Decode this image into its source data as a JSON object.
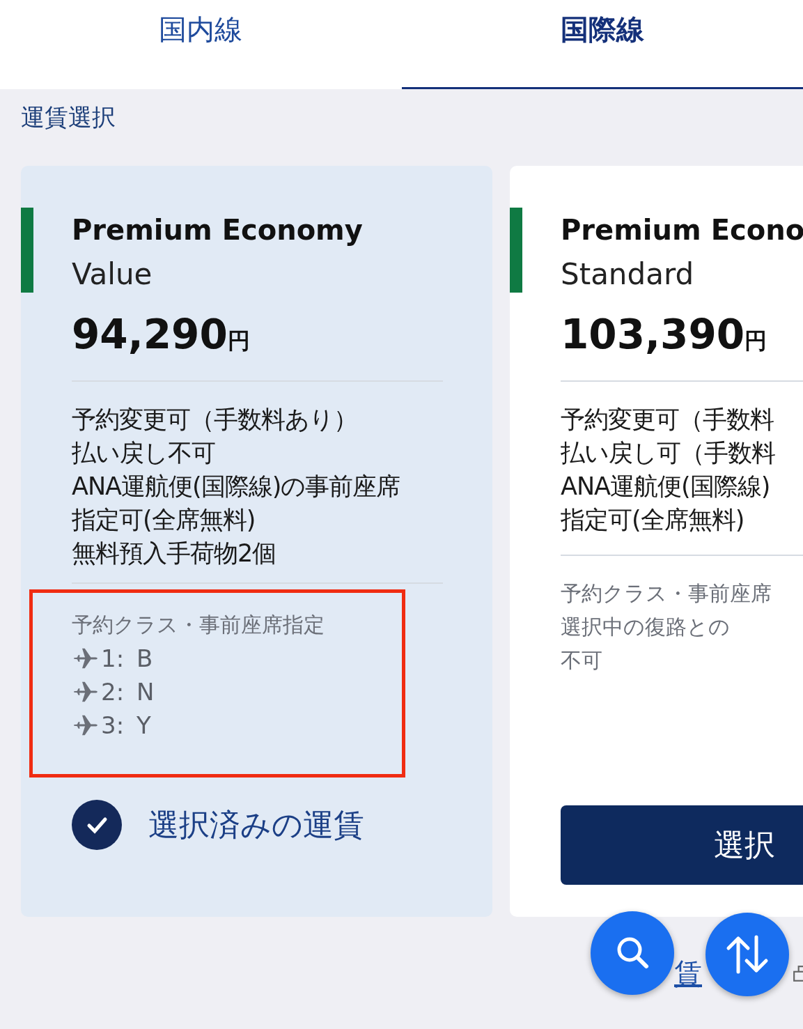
{
  "tabs": [
    {
      "label": "国内線",
      "selected": false
    },
    {
      "label": "国際線",
      "selected": true
    }
  ],
  "section_title": "運賃選択",
  "fares": [
    {
      "name": "Premium Economy",
      "type": "Value",
      "price": "94,290",
      "currency": "円",
      "conditions": [
        "予約変更可（手数料あり）",
        "払い戻し不可",
        "ANA運航便(国際線)の事前座席",
        "指定可(全席無料)",
        "無料預入手荷物2個"
      ],
      "class_heading": "予約クラス・事前座席指定",
      "class_lines": [
        {
          "segment": "1:",
          "class": "B"
        },
        {
          "segment": "2:",
          "class": "N"
        },
        {
          "segment": "3:",
          "class": "Y"
        }
      ],
      "highlighted": true,
      "selected": true,
      "selected_label": "選択済みの運賃"
    },
    {
      "name": "Premium Econo",
      "type": "Standard",
      "price": "103,390",
      "currency": "円",
      "conditions": [
        "予約変更可（手数料",
        "払い戻し可（手数料",
        "ANA運航便(国際線)",
        "指定可(全席無料)"
      ],
      "class_heading": "予約クラス・事前座席",
      "notes": [
        "選択中の復路との",
        "不可"
      ],
      "highlighted": false,
      "selected": false,
      "select_button": "選択"
    }
  ],
  "link": {
    "text": "賃"
  }
}
